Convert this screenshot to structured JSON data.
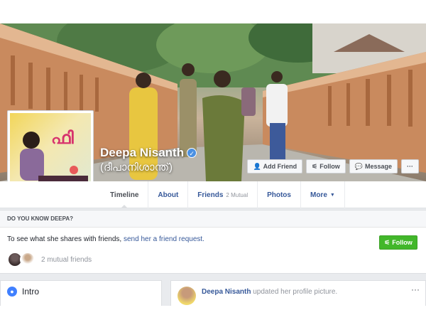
{
  "profile": {
    "name": "Deepa Nisanth",
    "alt_name": "(ദീപാനിശാന്ത്)",
    "verified_glyph": "✓",
    "avatar_text": "ഫി",
    "avatar_logo": "rose"
  },
  "cover_actions": [
    {
      "label": "Add Friend",
      "icon": "add-friend-icon",
      "glyph": "👤"
    },
    {
      "label": "Follow",
      "icon": "rss-icon",
      "glyph": "⚟"
    },
    {
      "label": "Message",
      "icon": "messenger-icon",
      "glyph": "💬"
    },
    {
      "label": "···",
      "icon": "more-icon"
    }
  ],
  "nav": {
    "timeline": "Timeline",
    "about": "About",
    "friends": "Friends",
    "friends_sub": "2 Mutual",
    "photos": "Photos",
    "more": "More",
    "more_caret": "▼"
  },
  "know": {
    "title": "DO YOU KNOW DEEPA?",
    "text_prefix": "To see what she shares with friends, ",
    "link": "send her a friend request.",
    "follow_label": "Follow",
    "follow_icon": "rss-icon",
    "mutual_text": "2 mutual friends"
  },
  "intro": {
    "title": "Intro",
    "icon": "globe-icon",
    "glyph": "●"
  },
  "post": {
    "author": "Deepa Nisanth",
    "action": " updated her profile picture.",
    "more": "···"
  },
  "colors": {
    "link": "#365899",
    "green": "#42b72a",
    "verified": "#4a90e2"
  }
}
